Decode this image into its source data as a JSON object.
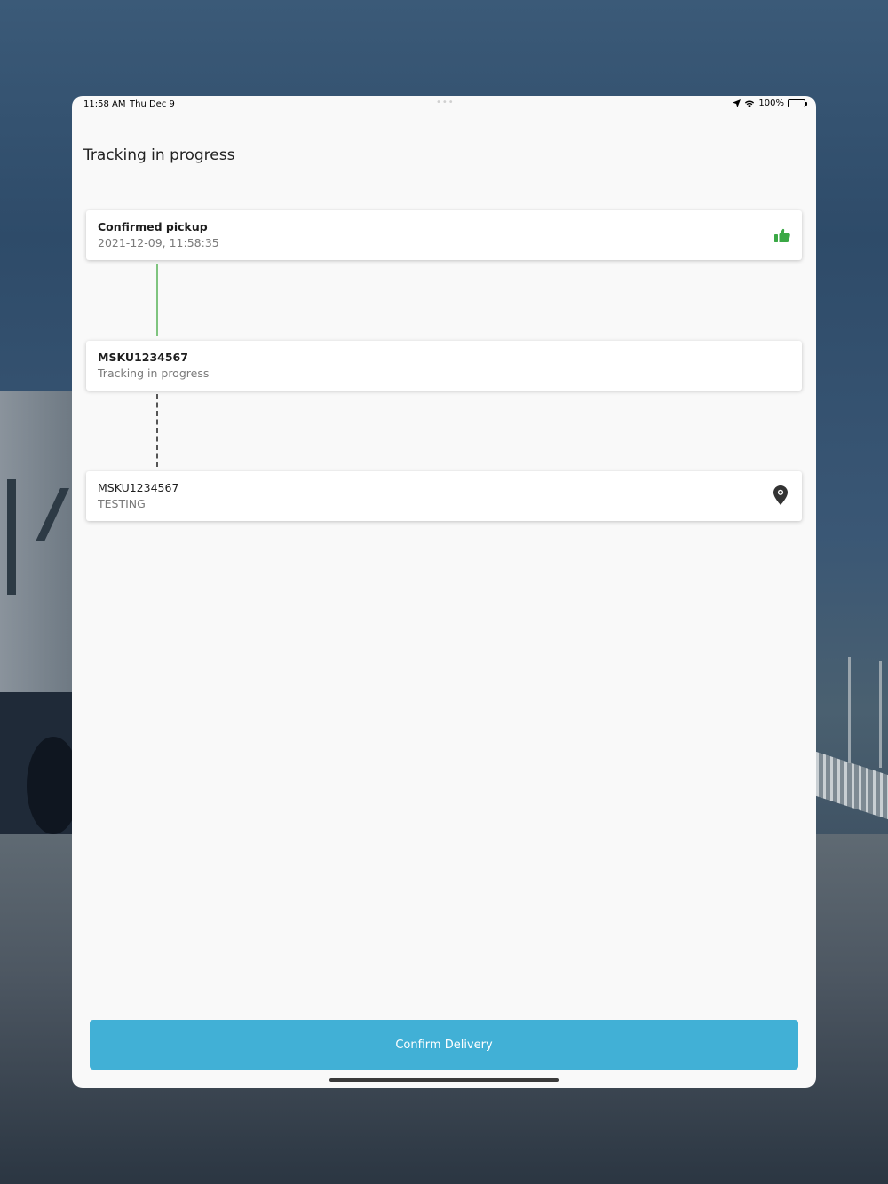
{
  "status_bar": {
    "time": "11:58 AM",
    "date": "Thu Dec 9",
    "battery": "100%",
    "icons": [
      "location-arrow-icon",
      "wifi-icon",
      "battery-icon"
    ]
  },
  "header": {
    "title": "Tracking in progress"
  },
  "timeline": [
    {
      "title": "Confirmed pickup",
      "subtitle": "2021-12-09, 11:58:35",
      "icon": "thumbs-up-icon",
      "icon_color": "#3aa845"
    },
    {
      "title": "MSKU1234567",
      "subtitle": "Tracking in progress"
    },
    {
      "title": "MSKU1234567",
      "subtitle": "TESTING",
      "icon": "map-pin-icon",
      "icon_color": "#333333"
    }
  ],
  "connector_colors": {
    "completed": "#7fc47f",
    "pending": "#555555"
  },
  "actions": {
    "confirm_label": "Confirm Delivery",
    "confirm_color": "#41b0d6"
  }
}
